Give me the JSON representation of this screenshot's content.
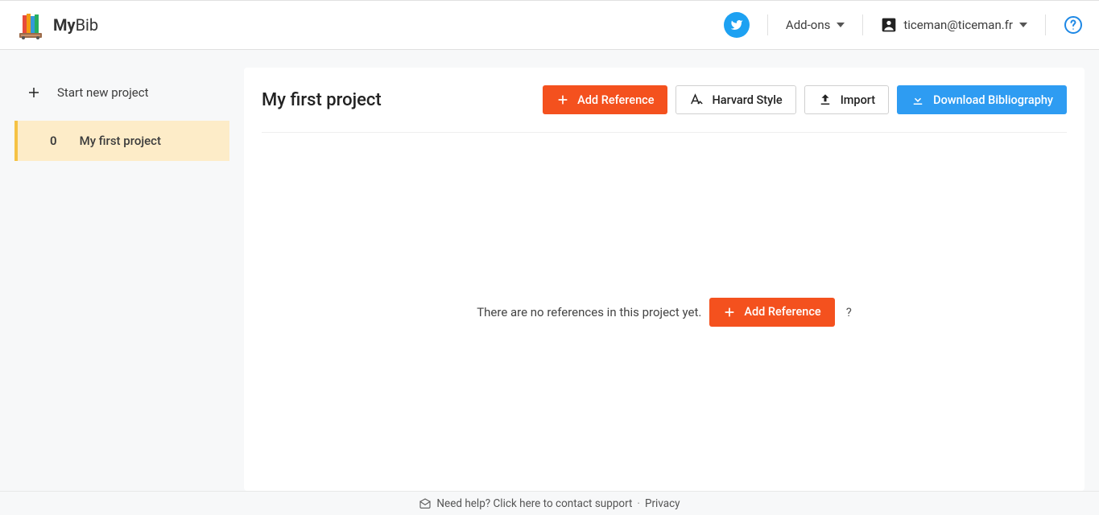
{
  "brand": {
    "part1": "My",
    "part2": "Bib"
  },
  "header": {
    "addons_label": "Add-ons",
    "user_email": "ticeman@ticeman.fr"
  },
  "sidebar": {
    "new_project_label": "Start new project",
    "projects": [
      {
        "count": "0",
        "name": "My first project"
      }
    ]
  },
  "panel": {
    "title": "My first project",
    "add_reference_label": "Add Reference",
    "style_label": "Harvard Style",
    "import_label": "Import",
    "download_label": "Download Bibliography",
    "empty_message": "There are no references in this project yet.",
    "empty_add_label": "Add Reference",
    "question_mark": "?"
  },
  "footer": {
    "support_text": "Need help? Click here to contact support",
    "separator": "·",
    "privacy_label": "Privacy"
  }
}
